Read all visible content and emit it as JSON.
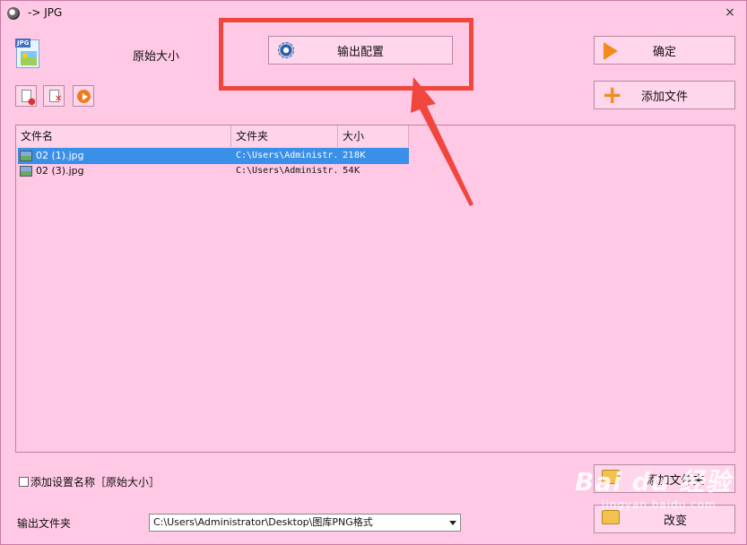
{
  "window": {
    "title": "-> JPG",
    "close_glyph": "×"
  },
  "preset": {
    "label": "原始大小"
  },
  "toolbar": {
    "output_config_label": "输出配置",
    "confirm_label": "确定",
    "add_file_label": "添加文件",
    "add_folder_label": "添加文件夹",
    "change_label": "改变"
  },
  "file_list": {
    "columns": [
      "文件名",
      "文件夹",
      "大小"
    ],
    "rows": [
      {
        "name": "02 (1).jpg",
        "folder": "C:\\Users\\Administr...",
        "size": "218K",
        "selected": true
      },
      {
        "name": "02 (3).jpg",
        "folder": "C:\\Users\\Administr...",
        "size": "54K",
        "selected": false
      }
    ]
  },
  "options": {
    "add_setting_name_label": "添加设置名称［原始大小］",
    "checked": false
  },
  "output": {
    "folder_label": "输出文件夹",
    "folder_path": "C:\\Users\\Administrator\\Desktop\\图库PNG格式"
  },
  "annotation": {
    "highlight_color": "#f0463e"
  },
  "watermark": {
    "main": "Bai du 经验",
    "sub": "jingyan.baidu.com"
  },
  "colors": {
    "background": "#ffc8e4",
    "selection": "#3a8fe8",
    "accent_orange": "#f28a1e"
  }
}
